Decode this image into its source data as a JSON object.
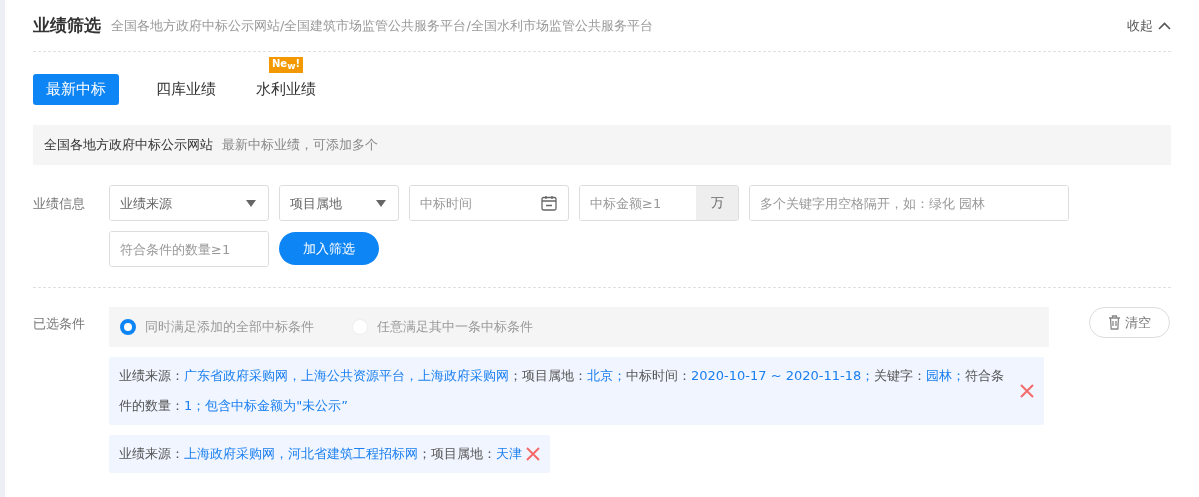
{
  "header": {
    "title": "业绩筛选",
    "subtitle": "全国各地方政府中标公示网站/全国建筑市场监管公共服务平台/全国水利市场监管公共服务平台",
    "collapse": "收起"
  },
  "tabs": [
    {
      "label": "最新中标",
      "selected": true
    },
    {
      "label": "四库业绩",
      "selected": false
    },
    {
      "label": "水利业绩",
      "selected": false,
      "badge": "Ne$_{w}$!"
    }
  ],
  "info_bar": {
    "source": "全国各地方政府中标公示网站",
    "hint": "最新中标业绩，可添加多个"
  },
  "form": {
    "label": "业绩信息",
    "fields": [
      {
        "kind": "select",
        "placeholder": "业绩来源"
      },
      {
        "kind": "select",
        "placeholder": "项目属地"
      },
      {
        "kind": "date",
        "placeholder": "中标时间"
      },
      {
        "kind": "amount",
        "placeholder": "中标金额≥1",
        "unit": "万"
      },
      {
        "kind": "text",
        "placeholder": "多个关键字用空格隔开，如：绿化 园林"
      },
      {
        "kind": "text",
        "placeholder": "符合条件的数量≥1"
      }
    ],
    "submit": "加入筛选"
  },
  "selected_conditions": {
    "label": "已选条件",
    "modes": [
      {
        "label": "同时满足添加的全部中标条件",
        "selected": true
      },
      {
        "label": "任意满足其中一条中标条件",
        "selected": false
      }
    ],
    "clear": "清空",
    "conditions": [
      {
        "parts": [
          {
            "text": "业绩来源：",
            "highlight": false
          },
          {
            "text": "广东省政府采购网，上海公共资源平台，上海政府采购网",
            "highlight": true
          },
          {
            "text": "；项目属地：",
            "highlight": false
          },
          {
            "text": "北京；",
            "highlight": true
          },
          {
            "text": "中标时间：",
            "highlight": false
          },
          {
            "text": "2020-10-17 ~ 2020-11-18；",
            "highlight": true
          },
          {
            "text": "关键字：",
            "highlight": false
          },
          {
            "text": "园林；",
            "highlight": true
          },
          {
            "text": "符合条件的数量：",
            "highlight": false
          },
          {
            "text": "1；包含中标金额为\"未公示”",
            "highlight": true
          }
        ]
      },
      {
        "parts": [
          {
            "text": "业绩来源：",
            "highlight": false
          },
          {
            "text": "上海政府采购网，河北省建筑工程招标网",
            "highlight": true
          },
          {
            "text": "；项目属地：",
            "highlight": false
          },
          {
            "text": "天津",
            "highlight": true
          }
        ]
      }
    ]
  }
}
